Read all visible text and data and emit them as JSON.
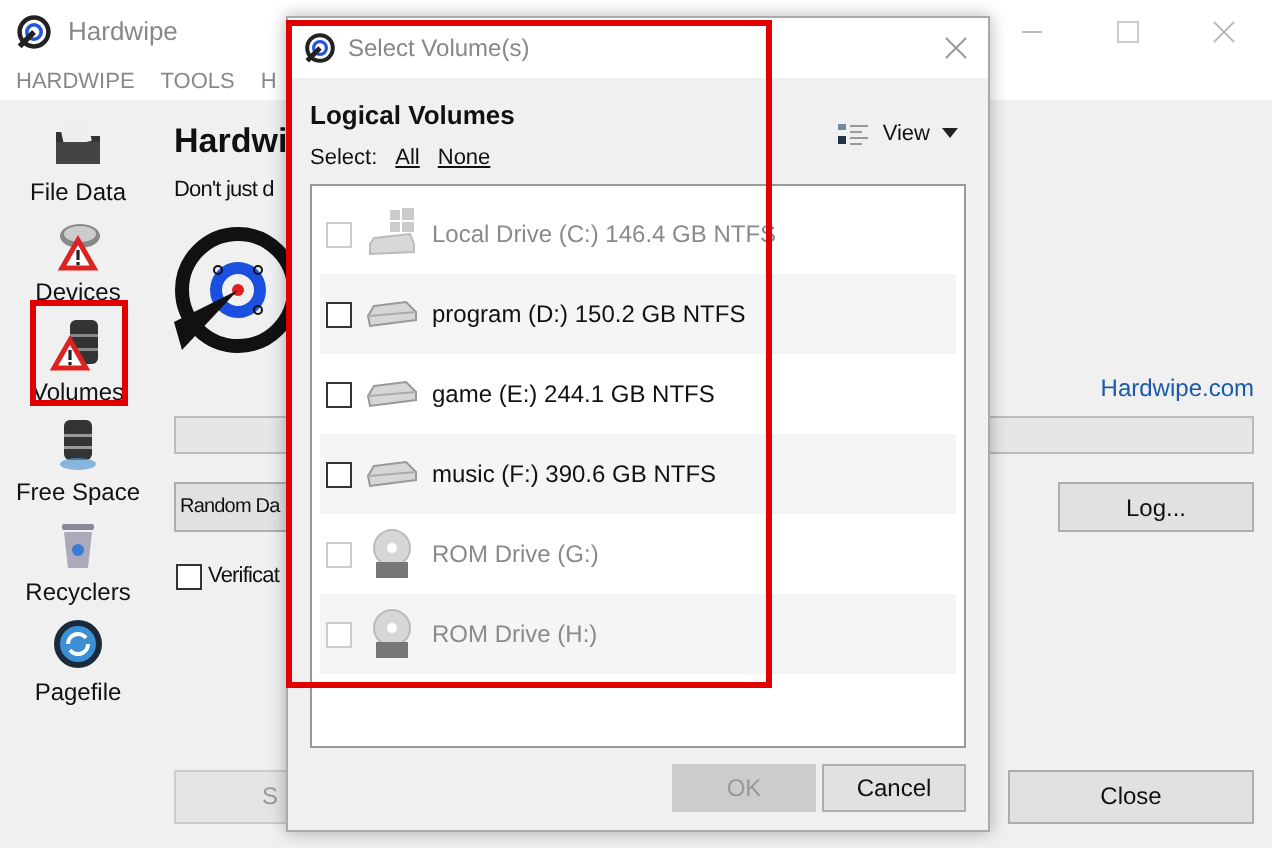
{
  "window": {
    "title": "Hardwipe"
  },
  "menu": [
    "HARDWIPE",
    "TOOLS",
    "H"
  ],
  "sidebar": [
    {
      "label": "File Data",
      "kind": "file",
      "highlighted": false
    },
    {
      "label": "Devices",
      "kind": "device",
      "highlighted": false
    },
    {
      "label": "Volumes",
      "kind": "volumes",
      "highlighted": true
    },
    {
      "label": "Free Space",
      "kind": "freespace",
      "highlighted": false
    },
    {
      "label": "Recyclers",
      "kind": "recycler",
      "highlighted": false
    },
    {
      "label": "Pagefile",
      "kind": "pagefile",
      "highlighted": false
    }
  ],
  "content": {
    "heading": "Hardwi",
    "subtitle": "Don't just d",
    "link": "Hardwipe.com",
    "progress": {
      "level": 0
    },
    "method": "Random Da",
    "log_button": "Log...",
    "verification": {
      "label": "Verificat",
      "checked": false
    },
    "start_button": "S",
    "close_button": "Close"
  },
  "dialog": {
    "title": "Select Volume(s)",
    "highlighted": true,
    "section": "Logical Volumes",
    "select_label": "Select:",
    "select_all": "All",
    "select_none": "None",
    "view_button": "View",
    "volumes": [
      {
        "label": "Local Drive (C:) 146.4 GB NTFS",
        "kind": "system",
        "checked": false,
        "disabled": true
      },
      {
        "label": "program (D:) 150.2 GB NTFS",
        "kind": "hdd",
        "checked": false,
        "disabled": false
      },
      {
        "label": "game (E:) 244.1 GB NTFS",
        "kind": "hdd",
        "checked": false,
        "disabled": false
      },
      {
        "label": "music (F:) 390.6 GB NTFS",
        "kind": "hdd",
        "checked": false,
        "disabled": false
      },
      {
        "label": "ROM Drive (G:)",
        "kind": "rom",
        "checked": false,
        "disabled": true
      },
      {
        "label": "ROM Drive (H:)",
        "kind": "rom",
        "checked": false,
        "disabled": true
      }
    ],
    "ok_button": {
      "label": "OK",
      "disabled": true
    },
    "cancel_button": "Cancel"
  }
}
